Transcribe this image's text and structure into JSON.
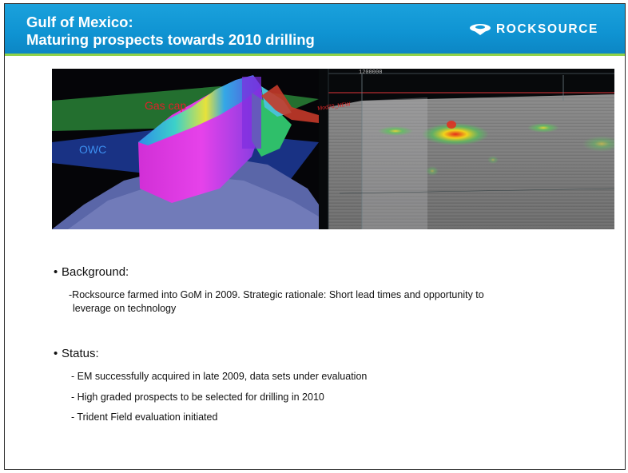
{
  "header": {
    "title_line1": "Gulf of Mexico:",
    "title_line2": "Maturing prospects towards 2010 drilling",
    "logo_text": "ROCKSOURCE",
    "bg_color": "#1198d6",
    "accent_line_color": "#8fd24a"
  },
  "image": {
    "label_gas_cap": "Gas cap",
    "label_owc": "OWC",
    "scale_label": "1200000",
    "section_tag": "Mod70_NEW"
  },
  "background": {
    "heading": "Background:",
    "line1": "-Rocksource farmed into GoM in 2009. Strategic rationale: Short lead times and opportunity to",
    "line2": "leverage on technology"
  },
  "status": {
    "heading": "Status:",
    "items": [
      "- EM successfully acquired in late 2009, data sets under evaluation",
      "- High graded prospects to be selected for drilling in 2010",
      "- Trident Field evaluation initiated"
    ]
  },
  "bullet_glyph": "•"
}
